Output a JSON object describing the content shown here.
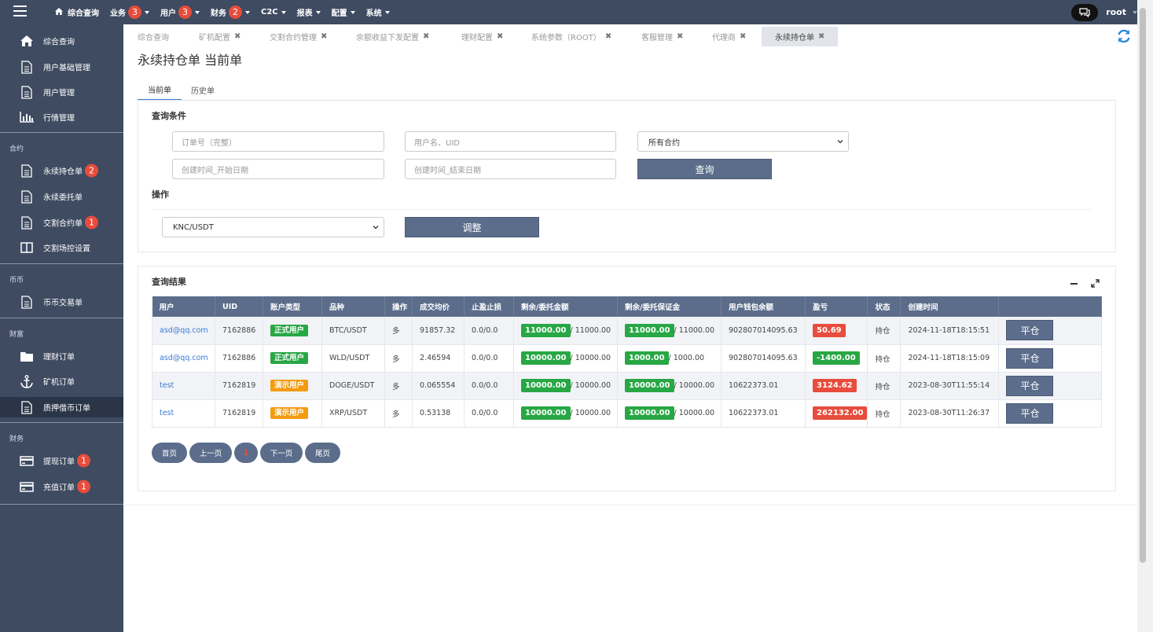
{
  "topbar": {
    "home_label": "综合查询",
    "nav": [
      {
        "label": "业务",
        "badge": "3"
      },
      {
        "label": "用户",
        "badge": "3"
      },
      {
        "label": "财务",
        "badge": "2"
      },
      {
        "label": "C2C",
        "badge": ""
      },
      {
        "label": "报表",
        "badge": ""
      },
      {
        "label": "配置",
        "badge": ""
      },
      {
        "label": "系统",
        "badge": ""
      }
    ],
    "username": "root"
  },
  "sidebar": {
    "items": [
      {
        "label": "综合查询",
        "icon": "home-icon",
        "badge": ""
      },
      {
        "label": "用户基础管理",
        "icon": "file-icon",
        "badge": ""
      },
      {
        "label": "用户管理",
        "icon": "file-icon",
        "badge": ""
      },
      {
        "label": "行情管理",
        "icon": "bar-chart-icon",
        "badge": ""
      },
      {
        "label": "永续持仓单",
        "icon": "file-icon",
        "badge": "2"
      },
      {
        "label": "永续委托单",
        "icon": "file-icon",
        "badge": ""
      },
      {
        "label": "交割合约单",
        "icon": "file-icon",
        "badge": "1"
      },
      {
        "label": "交割场控设置",
        "icon": "columns-icon",
        "badge": ""
      },
      {
        "label": "币币交易单",
        "icon": "file-icon",
        "badge": ""
      },
      {
        "label": "理财订单",
        "icon": "folder-icon",
        "badge": ""
      },
      {
        "label": "矿机订单",
        "icon": "anchor-icon",
        "badge": ""
      },
      {
        "label": "质押借币订单",
        "icon": "file-icon",
        "badge": ""
      },
      {
        "label": "提现订单",
        "icon": "card-icon",
        "badge": "1"
      },
      {
        "label": "充值订单",
        "icon": "card-icon",
        "badge": "1"
      }
    ],
    "sections": [
      "合约",
      "币币",
      "财富",
      "财务"
    ]
  },
  "tabs": [
    {
      "label": "综合查询",
      "closable": false
    },
    {
      "label": "矿机配置",
      "closable": true
    },
    {
      "label": "交割合约管理",
      "closable": true
    },
    {
      "label": "余额收益下发配置",
      "closable": true
    },
    {
      "label": "理财配置",
      "closable": true
    },
    {
      "label": "系统参数（ROOT）",
      "closable": true
    },
    {
      "label": "客服管理",
      "closable": true
    },
    {
      "label": "代理商",
      "closable": true
    },
    {
      "label": "永续持仓单",
      "closable": true
    }
  ],
  "page": {
    "title": "永续持仓单 当前单",
    "subtabs": [
      "当前单",
      "历史单"
    ]
  },
  "query": {
    "title": "查询条件",
    "order_no_placeholder": "订单号（完整）",
    "user_placeholder": "用户名、UID",
    "contract_select": "所有合约",
    "start_placeholder": "创建时间_开始日期",
    "end_placeholder": "创建时间_结束日期",
    "search_label": "查询",
    "ops_title": "操作",
    "pair_select": "KNC/USDT",
    "adjust_label": "调整"
  },
  "results": {
    "title": "查询结果",
    "columns": [
      "用户",
      "UID",
      "账户类型",
      "品种",
      "操作",
      "成交均价",
      "止盈止损",
      "剩余/委托金额",
      "剩余/委托保证金",
      "用户钱包余额",
      "盈亏",
      "状态",
      "创建时间",
      ""
    ],
    "rows": [
      {
        "user": "asd@qq.com",
        "uid": "7162886",
        "acct": "正式用户",
        "acct_color": "green",
        "pair": "BTC/USDT",
        "op": "多",
        "price": "91857.32",
        "tpsl": "0.0/0.0",
        "amt_rem": "11000.00",
        "amt_total": "/ 11000.00",
        "margin_rem": "11000.00",
        "margin_total": "/ 11000.00",
        "wallet": "902807014095.63",
        "pnl": "50.69",
        "pnl_color": "red",
        "status": "持仓",
        "created": "2024-11-18T18:15:51",
        "action": "平仓"
      },
      {
        "user": "asd@qq.com",
        "uid": "7162886",
        "acct": "正式用户",
        "acct_color": "green",
        "pair": "WLD/USDT",
        "op": "多",
        "price": "2.46594",
        "tpsl": "0.0/0.0",
        "amt_rem": "10000.00",
        "amt_total": "/ 10000.00",
        "margin_rem": "1000.00",
        "margin_total": "/ 1000.00",
        "wallet": "902807014095.63",
        "pnl": "-1400.00",
        "pnl_color": "green",
        "status": "持仓",
        "created": "2024-11-18T18:15:09",
        "action": "平仓"
      },
      {
        "user": "test",
        "uid": "7162819",
        "acct": "演示用户",
        "acct_color": "orange",
        "pair": "DOGE/USDT",
        "op": "多",
        "price": "0.065554",
        "tpsl": "0.0/0.0",
        "amt_rem": "10000.00",
        "amt_total": "/ 10000.00",
        "margin_rem": "10000.00",
        "margin_total": "/ 10000.00",
        "wallet": "10622373.01",
        "pnl": "3124.62",
        "pnl_color": "red",
        "status": "持仓",
        "created": "2023-08-30T11:55:14",
        "action": "平仓"
      },
      {
        "user": "test",
        "uid": "7162819",
        "acct": "演示用户",
        "acct_color": "orange",
        "pair": "XRP/USDT",
        "op": "多",
        "price": "0.53138",
        "tpsl": "0.0/0.0",
        "amt_rem": "10000.00",
        "amt_total": "/ 10000.00",
        "margin_rem": "10000.00",
        "margin_total": "/ 10000.00",
        "wallet": "10622373.01",
        "pnl": "262132.00",
        "pnl_color": "red",
        "status": "持仓",
        "created": "2023-08-30T11:26:37",
        "action": "平仓"
      }
    ]
  },
  "pagination": {
    "first": "首页",
    "prev": "上一页",
    "current": "1",
    "next": "下一页",
    "last": "尾页"
  },
  "colors": {
    "header_bg": "#3e4b61",
    "primary_btn": "#5b6d8b",
    "badge": "#e74c3c",
    "green_label": "#28a745",
    "orange_label": "#f39c12",
    "link": "#3a7bd5"
  }
}
